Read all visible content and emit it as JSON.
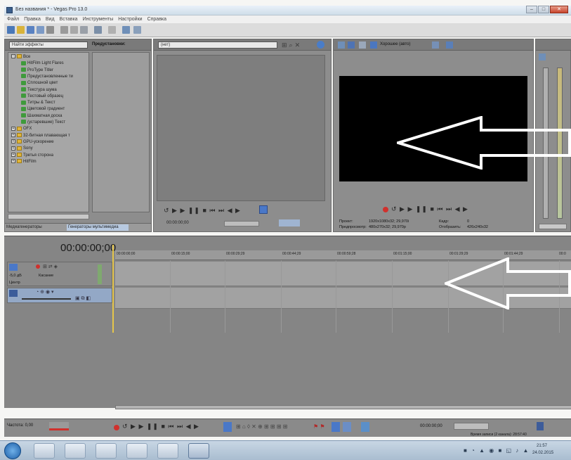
{
  "window": {
    "title": "Без названия * - Vegas Pro 13.0",
    "min_label": "–",
    "max_label": "□",
    "close_label": "✕"
  },
  "menu": [
    "Файл",
    "Правка",
    "Вид",
    "Вставка",
    "Инструменты",
    "Настройки",
    "Справка"
  ],
  "effects_panel": {
    "search_placeholder": "Найти эффекты",
    "presets_header": "Предустановки:",
    "tree": [
      {
        "kind": "folder",
        "label": "Все"
      },
      {
        "kind": "fx",
        "label": "HitFilm Light Flares"
      },
      {
        "kind": "fx",
        "label": "ProType Titler"
      },
      {
        "kind": "fx",
        "label": "Предустановленные ти"
      },
      {
        "kind": "fx",
        "label": "Сплошной цвет"
      },
      {
        "kind": "fx",
        "label": "Текстура шума"
      },
      {
        "kind": "fx",
        "label": "Тестовый образец"
      },
      {
        "kind": "fx",
        "label": "Титры & Текст"
      },
      {
        "kind": "fx",
        "label": "Цветовой градиент"
      },
      {
        "kind": "fx",
        "label": "Шахматная доска"
      },
      {
        "kind": "fx",
        "label": "(устаревшие) Текст"
      },
      {
        "kind": "group",
        "label": "OFX"
      },
      {
        "kind": "group",
        "label": "32-битная плавающая т"
      },
      {
        "kind": "group",
        "label": "GPU-ускорение"
      },
      {
        "kind": "group",
        "label": "Sony"
      },
      {
        "kind": "group",
        "label": "Третья сторона"
      },
      {
        "kind": "group",
        "label": "HitFilm"
      }
    ],
    "tab_left": "Медиагенераторы",
    "tab_active": "Генераторы мультимедиа"
  },
  "trimmer": {
    "dropdown": "(нет)",
    "timecode": "00:00:00;00"
  },
  "preview": {
    "quality": "Хорошее (авто)",
    "project_label": "Проект:",
    "project_value": "1920x1080x32; 29,970i",
    "preview_label": "Предпросмотр:",
    "preview_value": "480x270x32; 29,970p",
    "frame_label": "Кадр:",
    "frame_value": "0",
    "display_label": "Отобразить:",
    "display_value": "426x240x32"
  },
  "timeline": {
    "timecode": "00:00:00;00",
    "ruler_ticks": [
      "00:00:00;00",
      "00:00:15;00",
      "00:00:29;29",
      "00:00:44;29",
      "00:00:59;28",
      "00:01:15;00",
      "00:01:29;29",
      "00:01:44;29",
      "00:0"
    ],
    "audio_track": {
      "db": "-5,0 дБ",
      "mode": "Касание",
      "pan": "Центр"
    }
  },
  "bottom": {
    "rate_label": "Частота: 0,00",
    "timecode": "00:00:00;00",
    "record_time": "Время записи (2 канала): 28:57:40"
  },
  "taskbar": {
    "clock_time": "21:57",
    "clock_date": "24.02.2015"
  },
  "colors": {
    "panel": "#8d8d8d",
    "preview_screen": "#000000",
    "record_button": "#d0312d",
    "taskbar": "#b8c9da"
  },
  "icons": [
    "folder-icon",
    "effect-icon",
    "record-icon",
    "play-icon",
    "stop-icon",
    "arrow-annotation-icon"
  ]
}
